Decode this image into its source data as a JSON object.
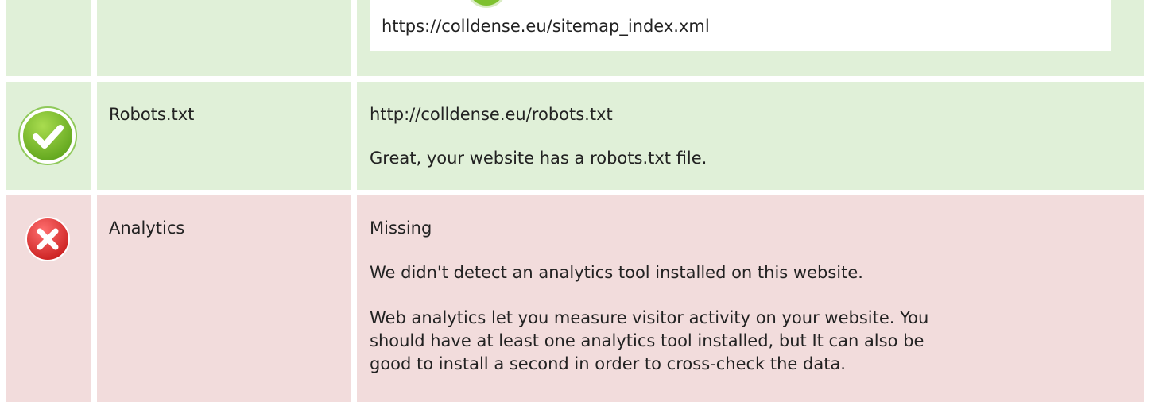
{
  "sitemap": {
    "url": "https://colldense.eu/sitemap_index.xml"
  },
  "robots": {
    "label": "Robots.txt",
    "url": "http://colldense.eu/robots.txt",
    "message": "Great, your website has a robots.txt file.",
    "status_icon": "check-icon",
    "color": "#e0f0d8"
  },
  "analytics": {
    "label": "Analytics",
    "status": "Missing",
    "message": "We didn't detect an analytics tool installed on this website.",
    "description_lines": [
      "Web analytics let you measure visitor activity on your website. You",
      "should have at least one analytics tool installed, but It can also be",
      "good to install a second in order to cross-check the data."
    ],
    "status_icon": "error-icon",
    "color": "#f2dcdc"
  }
}
